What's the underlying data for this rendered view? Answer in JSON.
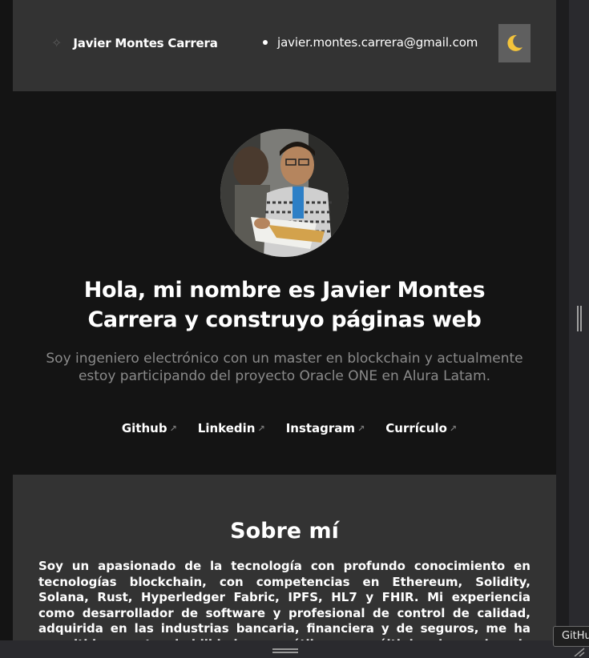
{
  "header": {
    "name": "Javier Montes Carrera",
    "email": "javier.montes.carrera@gmail.com",
    "theme_toggle_icon": "🌙"
  },
  "hero": {
    "headline": "Hola, mi nombre es Javier Montes Carrera y construyo páginas web",
    "intro": "Soy ingeniero electrónico con un master en blockchain y actualmente estoy participando del proyecto Oracle ONE en Alura Latam.",
    "links": [
      {
        "label": "Github",
        "icon": "arrow-up-right"
      },
      {
        "label": "Linkedin",
        "icon": "arrow-up-right"
      },
      {
        "label": "Instagram",
        "icon": "arrow-up-right"
      },
      {
        "label": "Currículo",
        "icon": "arrow-up-right"
      }
    ]
  },
  "about": {
    "title": "Sobre mí",
    "text": "Soy un apasionado de la tecnología con profundo conocimiento en tecnologías blockchain, con competencias en Ethereum, Solidity, Solana, Rust, Hyperledger Fabric, IPFS, HL7 y FHIR. Mi experiencia como desarrollador de software y profesional de control de calidad, adquirida en las industrias bancaria, financiera y de seguros, me ha permitido aportar habilidades versátiles en múltiples lenguajes de programación y diseño de bases de datos, así como capacidades de resolución de problemas."
  },
  "tooltip": {
    "text": "GitHu"
  },
  "colors": {
    "page_bg": "#141414",
    "panel_bg": "#333333",
    "muted_text": "#8a8a8a"
  }
}
